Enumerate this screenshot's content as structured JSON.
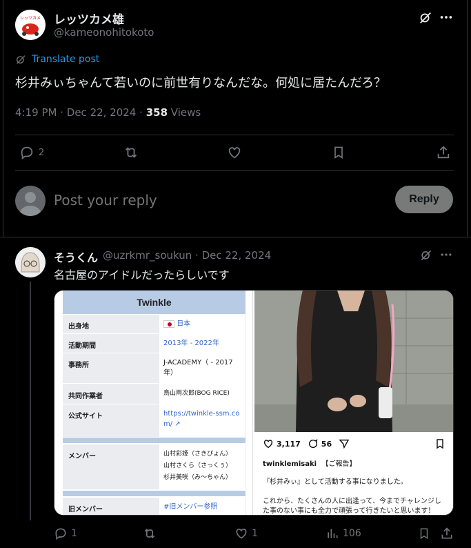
{
  "post": {
    "display_name": "レッツカメ雄",
    "handle": "@kameonohitokoto",
    "translate_label": "Translate post",
    "text": "杉井みぃちゃんて若いのに前世有りなんだな。何処に居たんだろ？",
    "time": "4:19 PM",
    "date": "Dec 22, 2024",
    "views_count": "358",
    "views_label": "Views",
    "reply_count": "2"
  },
  "composer": {
    "placeholder": "Post your reply",
    "button_label": "Reply"
  },
  "reply": {
    "display_name": "そうくん",
    "handle": "@uzrkmr_soukun",
    "date": "Dec 22, 2024",
    "text": "名古屋のアイドルだったらしいです",
    "reply_count": "1",
    "like_count": "1",
    "views_count": "106"
  },
  "wiki": {
    "title": "Twinkle",
    "rows": [
      {
        "label": "出身地",
        "value": "日本"
      },
      {
        "label": "活動期間",
        "value": "2013年 - 2022年"
      },
      {
        "label": "事務所",
        "value": "J-ACADEMY（ - 2017年）"
      },
      {
        "label": "共同作業者",
        "value": "鳥山雨次郎(BOG RICE)"
      },
      {
        "label": "公式サイト",
        "value": "https://twinkle-ssm.com/"
      },
      {
        "label": "メンバー",
        "value": "山村彩姫（さきぴょん）"
      },
      {
        "label": "member2",
        "value": "山村さくら（さっくぅ）"
      },
      {
        "label": "member3",
        "value": "杉井美咲（み～ちゃん）"
      },
      {
        "label": "旧メンバー",
        "value": "#旧メンバー参照"
      }
    ]
  },
  "instagram": {
    "likes": "3,117",
    "comments": "56",
    "username": "twinklemisaki",
    "tag": "【ご報告】",
    "line1": "『杉井みぃ』として活動する事になりました。",
    "line2": "これから、たくさんの人に出逢って、今までチャレンジし",
    "line3": "た事のない事にも全力で頑張って行きたいと思います！"
  },
  "colors": {
    "background": "#000000",
    "accent": "#1d9bf0",
    "muted": "#71767b",
    "divider": "#2f3336",
    "reply_button": "#787a7a"
  },
  "icons": [
    "grok-icon",
    "more-icon",
    "translate-icon",
    "reply-icon",
    "repost-icon",
    "like-icon",
    "bookmark-icon",
    "share-icon",
    "views-icon",
    "avatar-placeholder-icon"
  ]
}
